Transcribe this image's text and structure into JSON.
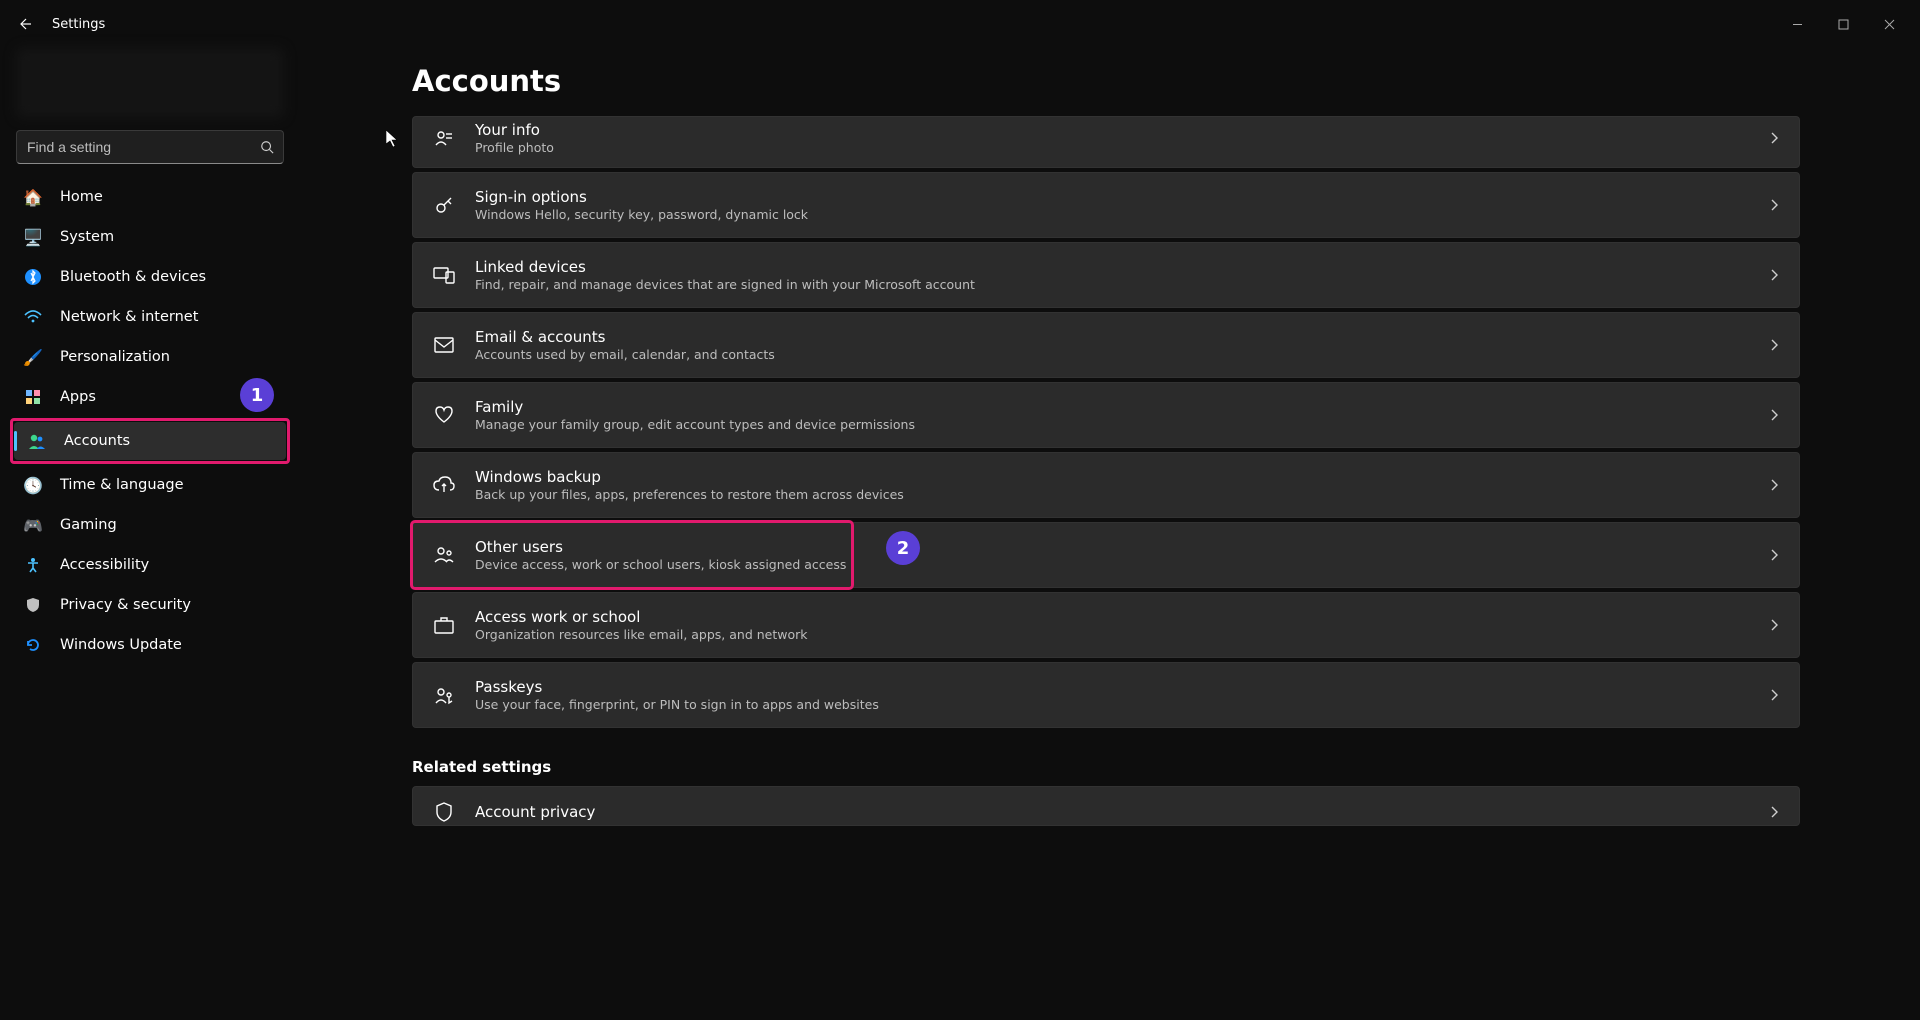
{
  "window": {
    "title": "Settings"
  },
  "search": {
    "placeholder": "Find a setting"
  },
  "sidebar": {
    "items": [
      {
        "label": "Home"
      },
      {
        "label": "System"
      },
      {
        "label": "Bluetooth & devices"
      },
      {
        "label": "Network & internet"
      },
      {
        "label": "Personalization"
      },
      {
        "label": "Apps"
      },
      {
        "label": "Accounts"
      },
      {
        "label": "Time & language"
      },
      {
        "label": "Gaming"
      },
      {
        "label": "Accessibility"
      },
      {
        "label": "Privacy & security"
      },
      {
        "label": "Windows Update"
      }
    ]
  },
  "page": {
    "title": "Accounts",
    "related_heading": "Related settings",
    "items": [
      {
        "title": "Your info",
        "subtitle": "Profile photo"
      },
      {
        "title": "Sign-in options",
        "subtitle": "Windows Hello, security key, password, dynamic lock"
      },
      {
        "title": "Linked devices",
        "subtitle": "Find, repair, and manage devices that are signed in with your Microsoft account"
      },
      {
        "title": "Email & accounts",
        "subtitle": "Accounts used by email, calendar, and contacts"
      },
      {
        "title": "Family",
        "subtitle": "Manage your family group, edit account types and device permissions"
      },
      {
        "title": "Windows backup",
        "subtitle": "Back up your files, apps, preferences to restore them across devices"
      },
      {
        "title": "Other users",
        "subtitle": "Device access, work or school users, kiosk assigned access"
      },
      {
        "title": "Access work or school",
        "subtitle": "Organization resources like email, apps, and network"
      },
      {
        "title": "Passkeys",
        "subtitle": "Use your face, fingerprint, or PIN to sign in to apps and websites"
      }
    ],
    "related_items": [
      {
        "title": "Account privacy",
        "subtitle": ""
      }
    ]
  },
  "callouts": {
    "one": "1",
    "two": "2"
  }
}
